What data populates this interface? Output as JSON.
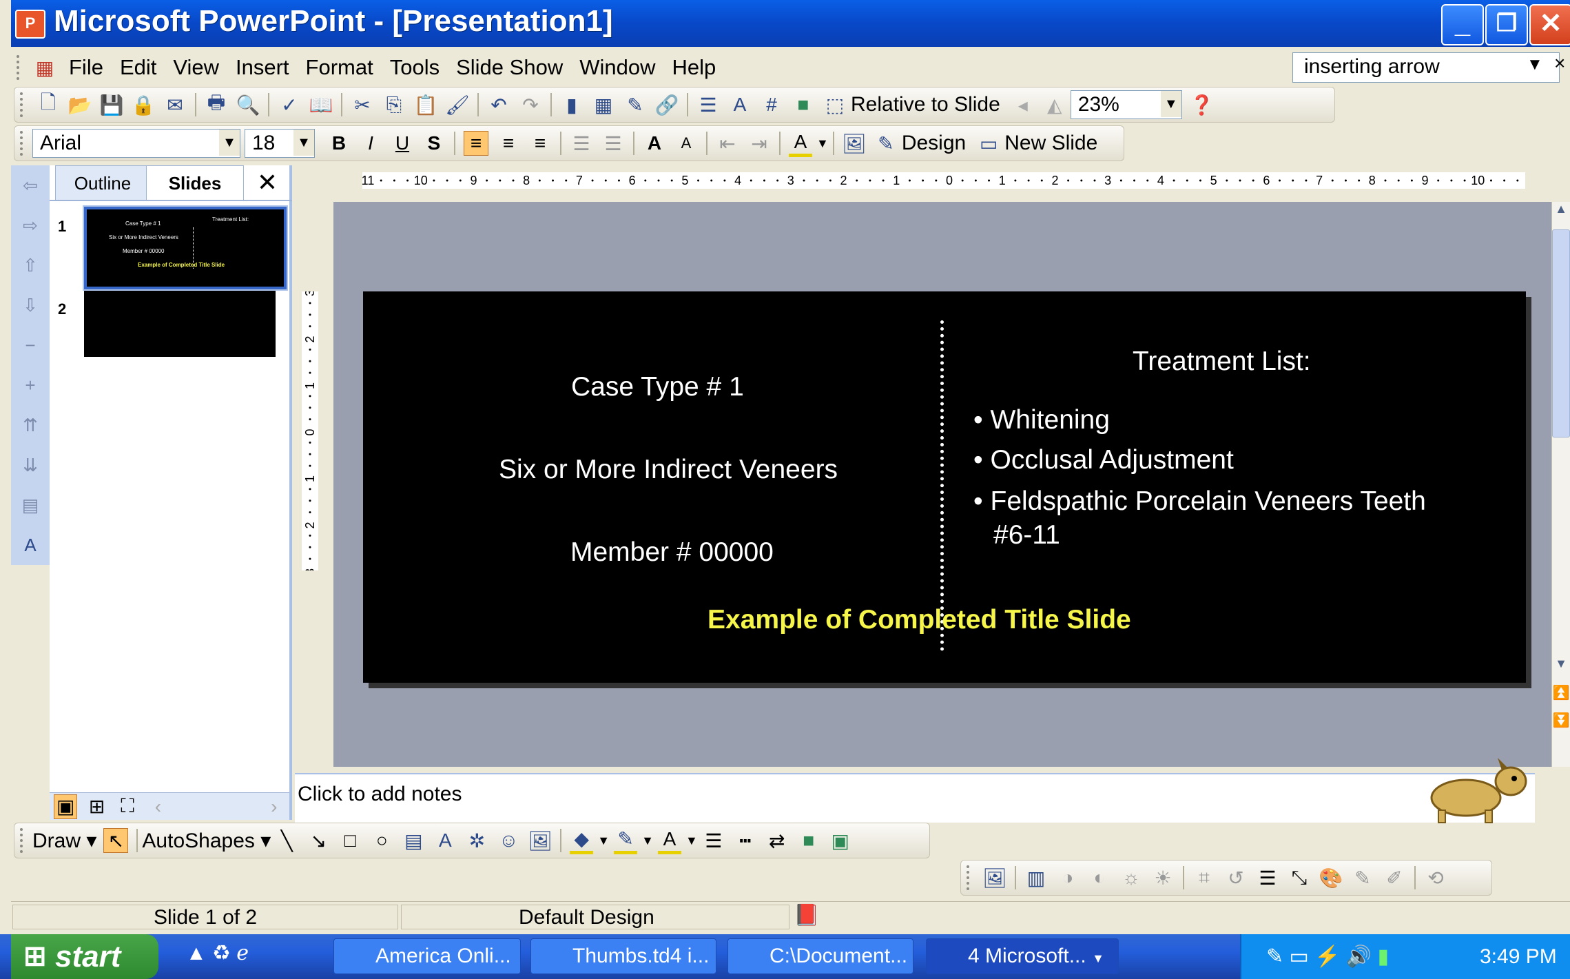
{
  "window": {
    "title": "Microsoft PowerPoint - [Presentation1]"
  },
  "menu": {
    "items": [
      "File",
      "Edit",
      "View",
      "Insert",
      "Format",
      "Tools",
      "Slide Show",
      "Window",
      "Help"
    ],
    "help_search": "inserting arrow"
  },
  "standard_toolbar": {
    "relative_to_slide": "Relative to Slide",
    "zoom": "23%"
  },
  "formatting_toolbar": {
    "font": "Arial",
    "size": "18",
    "bold": "B",
    "italic": "I",
    "underline": "U",
    "shadow": "S",
    "design": "Design",
    "new_slide": "New Slide"
  },
  "slides_pane": {
    "tabs": [
      "Outline",
      "Slides"
    ],
    "slide_numbers": [
      "1",
      "2"
    ]
  },
  "slide": {
    "left": {
      "line1": "Case Type # 1",
      "line2": "Six or More Indirect Veneers",
      "line3": "Member # 00000"
    },
    "right_title": "Treatment List:",
    "bullets": [
      "Whitening",
      "Occlusal Adjustment",
      "Feldspathic Porcelain Veneers Teeth",
      "#6-11"
    ],
    "footer": "Example of Completed Title Slide",
    "footer_color": "#f5f54a"
  },
  "ruler": {
    "h_labels": [
      "11",
      "10",
      "9",
      "8",
      "7",
      "6",
      "5",
      "4",
      "3",
      "2",
      "1",
      "0",
      "1",
      "2",
      "3",
      "4",
      "5",
      "6",
      "7",
      "8",
      "9",
      "10",
      "11"
    ],
    "v_labels": [
      "3",
      "2",
      "1",
      "0",
      "1",
      "2",
      "3"
    ]
  },
  "notes": {
    "placeholder": "Click to add notes"
  },
  "draw_toolbar": {
    "draw": "Draw",
    "autoshapes": "AutoShapes"
  },
  "status": {
    "slide": "Slide 1 of 2",
    "design": "Default Design"
  },
  "taskbar": {
    "start": "start",
    "tasks": [
      "America  Onli...",
      "Thumbs.td4 i...",
      "C:\\Document...",
      "4 Microsoft..."
    ],
    "clock": "3:49 PM"
  }
}
